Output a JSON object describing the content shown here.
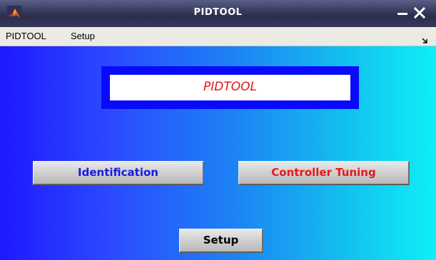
{
  "window": {
    "title": "PIDTOOL",
    "icon": "matlab-logo-icon"
  },
  "controls": {
    "minimize_icon": "minimize-icon",
    "close_icon": "close-icon"
  },
  "menubar": {
    "items": [
      {
        "label": "PIDTOOL"
      },
      {
        "label": "Setup"
      }
    ],
    "dock_icon": "dock-arrow-icon"
  },
  "main": {
    "title_label": "PIDTOOL",
    "buttons": {
      "identification": "Identification",
      "controller_tuning": "Controller Tuning",
      "setup": "Setup"
    }
  },
  "colors": {
    "gradient_start": "#1f18ff",
    "gradient_end": "#0ff0f6",
    "title_panel": "#0a0afa",
    "title_text": "#e0151c",
    "identification_text": "#1818e6",
    "controller_tuning_text": "#e8181c"
  }
}
